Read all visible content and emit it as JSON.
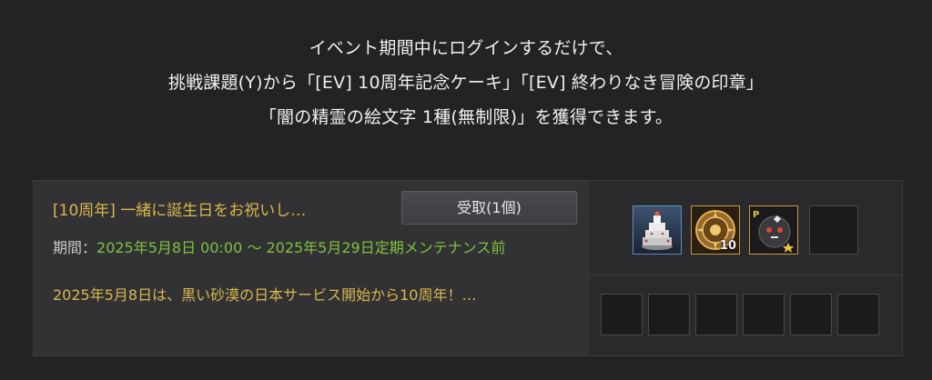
{
  "intro": {
    "line1": "イベント期間中にログインするだけで、",
    "line2": "挑戦課題(Y)から「[EV] 10周年記念ケーキ」「[EV] 終わりなき冒険の印章」",
    "line3": "「闇の精霊の絵文字 1種(無制限)」を獲得できます。"
  },
  "reward": {
    "title": "[10周年] 一緒に誕生日をお祝いし…",
    "claim_button": "受取(1個)",
    "period_label": "期間：",
    "period_value": "2025年5月8日 00:00 ～ 2025年5月29日定期メンテナンス前",
    "description": "2025年5月8日は、黒い砂漠の日本サービス開始から10周年！…",
    "items": [
      {
        "icon": "birthday-cake-icon"
      },
      {
        "icon": "adventure-seal-icon",
        "quantity": "10"
      },
      {
        "icon": "dark-spirit-emoji-icon",
        "badge": "P"
      }
    ],
    "empty_slots_top": 1,
    "empty_slots_bottom": 6
  },
  "colors": {
    "background": "#232326",
    "panel": "#323235",
    "title_gold": "#d9b84a",
    "period_green": "#7dc23c",
    "cake_frame": "#5a8ec2",
    "seal_frame": "#c69a3c"
  }
}
